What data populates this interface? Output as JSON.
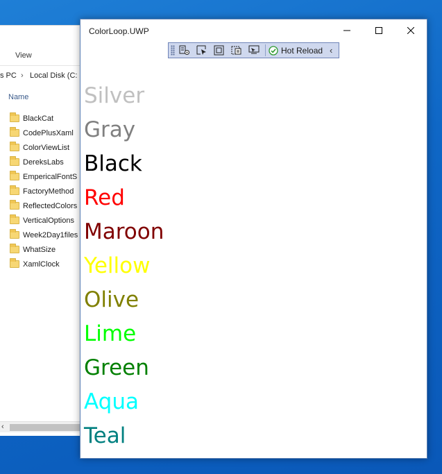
{
  "explorer": {
    "ribbon_view": "View",
    "breadcrumb": [
      "s PC",
      "Local Disk (C:"
    ],
    "column_header": "Name",
    "folders": [
      "BlackCat",
      "CodePlusXaml",
      "ColorViewList",
      "DereksLabs",
      "EmpericalFontS",
      "FactoryMethod",
      "ReflectedColors",
      "VerticalOptions",
      "Week2Day1files",
      "WhatSize",
      "XamlClock"
    ]
  },
  "app": {
    "title": "ColorLoop.UWP",
    "toolbar": {
      "hot_reload_label": "Hot Reload",
      "icons": [
        "live-visual-tree-icon",
        "select-element-icon",
        "display-adorners-icon",
        "track-focus-icon",
        "binding-failures-icon"
      ]
    },
    "colors": [
      {
        "name": "Silver",
        "hex": "#C0C0C0"
      },
      {
        "name": "Gray",
        "hex": "#808080"
      },
      {
        "name": "Black",
        "hex": "#000000"
      },
      {
        "name": "Red",
        "hex": "#FF0000"
      },
      {
        "name": "Maroon",
        "hex": "#800000"
      },
      {
        "name": "Yellow",
        "hex": "#FFFF00"
      },
      {
        "name": "Olive",
        "hex": "#808000"
      },
      {
        "name": "Lime",
        "hex": "#00FF00"
      },
      {
        "name": "Green",
        "hex": "#008000"
      },
      {
        "name": "Aqua",
        "hex": "#00FFFF"
      },
      {
        "name": "Teal",
        "hex": "#008080"
      }
    ]
  }
}
